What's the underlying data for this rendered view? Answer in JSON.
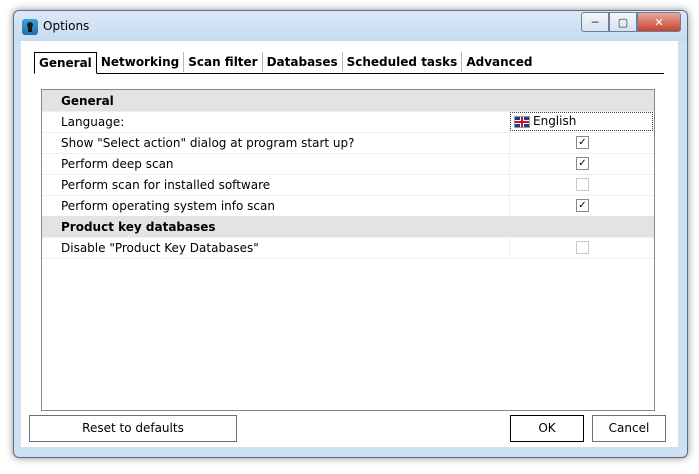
{
  "window": {
    "title": "Options",
    "controls": {
      "minimize": "─",
      "maximize": "▢",
      "close": "✕"
    }
  },
  "tabs": [
    {
      "label": "General",
      "active": true
    },
    {
      "label": "Networking",
      "active": false
    },
    {
      "label": "Scan filter",
      "active": false
    },
    {
      "label": "Databases",
      "active": false
    },
    {
      "label": "Scheduled tasks",
      "active": false
    },
    {
      "label": "Advanced",
      "active": false
    }
  ],
  "grid": {
    "sections": [
      {
        "header": "General",
        "rows": [
          {
            "label": "Language:",
            "type": "language",
            "value": "English",
            "flag": "uk-flag-icon"
          },
          {
            "label": "Show \"Select action\" dialog at program start up?",
            "type": "checkbox",
            "checked": true,
            "mark": "✓"
          },
          {
            "label": "Perform deep scan",
            "type": "checkbox",
            "checked": true,
            "mark": "✓"
          },
          {
            "label": "Perform scan for installed software",
            "type": "checkbox",
            "checked": false,
            "mark": ""
          },
          {
            "label": "Perform operating system info scan",
            "type": "checkbox",
            "checked": true,
            "mark": "✓"
          }
        ]
      },
      {
        "header": "Product key databases",
        "rows": [
          {
            "label": "Disable \"Product Key Databases\"",
            "type": "checkbox",
            "checked": false,
            "mark": ""
          }
        ]
      }
    ]
  },
  "buttons": {
    "reset": "Reset to defaults",
    "ok": "OK",
    "cancel": "Cancel"
  }
}
